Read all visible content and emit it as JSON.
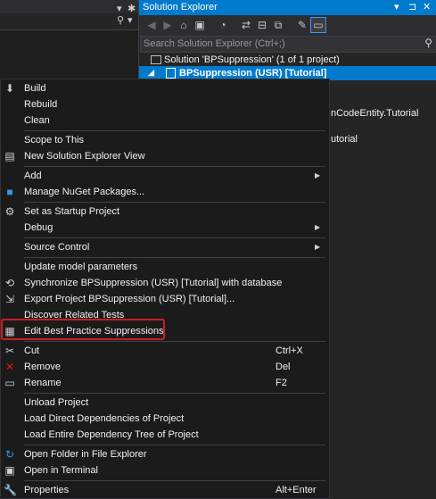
{
  "left_toolbar": {
    "dropdown_glyph": "▾",
    "gear_glyph": "✱",
    "search_glyph": "⚲"
  },
  "solution_explorer": {
    "title": "Solution Explorer",
    "title_buttons": [
      "▾",
      "⊐",
      "✕"
    ],
    "toolbar_icons": [
      "back-icon",
      "forward-icon",
      "home-icon",
      "pending-changes-filter-icon",
      "sync-icon",
      "collapse-all-icon",
      "show-all-files-icon",
      "properties-icon",
      "preview-selected-items-icon"
    ],
    "search_placeholder": "Search Solution Explorer (Ctrl+;)",
    "solution_label": "Solution 'BPSuppression' (1 of 1 project)",
    "project_label": "BPSuppression (USR) [Tutorial]",
    "partial_text_1": "nCodeEntity.Tutorial",
    "partial_text_2": "utorial",
    "accent_color": "#007acc"
  },
  "context_menu": {
    "items": [
      {
        "label": "Build",
        "icon": "build-icon",
        "shortcut": "",
        "submenu": false
      },
      {
        "label": "Rebuild",
        "icon": "",
        "shortcut": "",
        "submenu": false
      },
      {
        "label": "Clean",
        "icon": "",
        "shortcut": "",
        "submenu": false
      },
      {
        "label": "Scope to This",
        "icon": "",
        "shortcut": "",
        "submenu": false
      },
      {
        "label": "New Solution Explorer View",
        "icon": "new-view-icon",
        "shortcut": "",
        "submenu": false
      },
      {
        "label": "Add",
        "icon": "",
        "shortcut": "",
        "submenu": true
      },
      {
        "label": "Manage NuGet Packages...",
        "icon": "nuget-icon",
        "shortcut": "",
        "submenu": false
      },
      {
        "label": "Set as Startup Project",
        "icon": "gear-icon",
        "shortcut": "",
        "submenu": false
      },
      {
        "label": "Debug",
        "icon": "",
        "shortcut": "",
        "submenu": true
      },
      {
        "label": "Source Control",
        "icon": "",
        "shortcut": "",
        "submenu": true
      },
      {
        "label": "Update model parameters",
        "icon": "",
        "shortcut": "",
        "submenu": false
      },
      {
        "label": "Synchronize BPSuppression (USR) [Tutorial] with database",
        "icon": "sync-database-icon",
        "shortcut": "",
        "submenu": false
      },
      {
        "label": "Export Project BPSuppression (USR) [Tutorial]...",
        "icon": "export-icon",
        "shortcut": "",
        "submenu": false
      },
      {
        "label": "Discover Related Tests",
        "icon": "",
        "shortcut": "",
        "submenu": false
      },
      {
        "label": "Edit Best Practice Suppressions",
        "icon": "suppressions-document-icon",
        "shortcut": "",
        "submenu": false
      },
      {
        "label": "Cut",
        "icon": "scissors-icon",
        "shortcut": "Ctrl+X",
        "submenu": false
      },
      {
        "label": "Remove",
        "icon": "remove-x-icon",
        "shortcut": "Del",
        "submenu": false
      },
      {
        "label": "Rename",
        "icon": "rename-icon",
        "shortcut": "F2",
        "submenu": false
      },
      {
        "label": "Unload Project",
        "icon": "",
        "shortcut": "",
        "submenu": false
      },
      {
        "label": "Load Direct Dependencies of Project",
        "icon": "",
        "shortcut": "",
        "submenu": false
      },
      {
        "label": "Load Entire Dependency Tree of Project",
        "icon": "",
        "shortcut": "",
        "submenu": false
      },
      {
        "label": "Open Folder in File Explorer",
        "icon": "refresh-folder-icon",
        "shortcut": "",
        "submenu": false
      },
      {
        "label": "Open in Terminal",
        "icon": "terminal-icon",
        "shortcut": "",
        "submenu": false
      },
      {
        "label": "Properties",
        "icon": "properties-wrench-icon",
        "shortcut": "Alt+Enter",
        "submenu": false
      }
    ],
    "highlighted_item": "Edit Best Practice Suppressions",
    "highlight_color": "#cc1f1f"
  }
}
